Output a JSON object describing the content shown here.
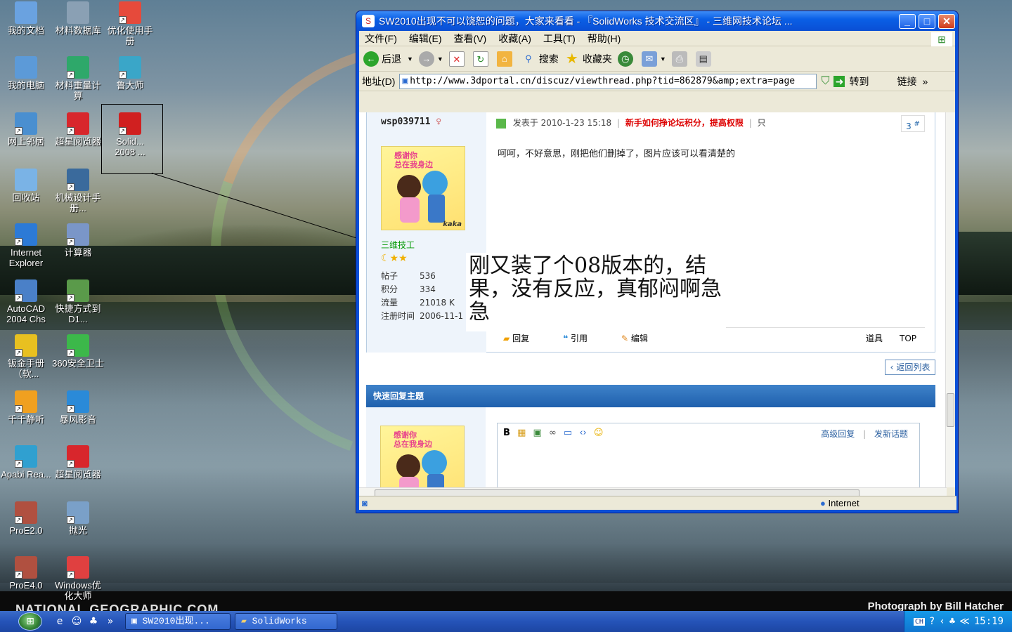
{
  "desktop": {
    "icons": [
      {
        "label": "我的文档",
        "icon": "documents-icon",
        "color": "#6aa2e0"
      },
      {
        "label": "材料数据库",
        "icon": "database-icon",
        "color": "#8aa0b4"
      },
      {
        "label": "优化使用手册",
        "icon": "manual-icon",
        "color": "#e64a3b"
      },
      {
        "label": "我的电脑",
        "icon": "computer-icon",
        "color": "#5c9ad8"
      },
      {
        "label": "材料重量计算",
        "icon": "calculator-icon",
        "color": "#2ea86a"
      },
      {
        "label": "鲁大师",
        "icon": "ludashi-icon",
        "color": "#3aa6c8"
      },
      {
        "label": "网上邻居",
        "icon": "network-icon",
        "color": "#4a8fd0"
      },
      {
        "label": "超星阅览器",
        "icon": "reader-icon",
        "color": "#d8262c"
      },
      {
        "label": "Solid...\n2008 ...",
        "icon": "solidworks-icon",
        "color": "#d02020"
      },
      {
        "label": "回收站",
        "icon": "recycle-bin-icon",
        "color": "#7ab3e6"
      },
      {
        "label": "机械设计手册...",
        "icon": "mech-design-icon",
        "color": "#3a6a9c"
      },
      {
        "label": "Internet Explorer",
        "icon": "ie-icon",
        "color": "#2c7ad6"
      },
      {
        "label": "计算器",
        "icon": "calculator-icon",
        "color": "#7a96c8"
      },
      {
        "label": "AutoCAD 2004 Chs",
        "icon": "autocad-icon",
        "color": "#4a80c8"
      },
      {
        "label": "快捷方式到 D1...",
        "icon": "shortcut-icon",
        "color": "#5a9a4a"
      },
      {
        "label": "钣金手册（软...",
        "icon": "sheetmetal-icon",
        "color": "#e8c020"
      },
      {
        "label": "360安全卫士",
        "icon": "360-icon",
        "color": "#3cb84a"
      },
      {
        "label": "千千静听",
        "icon": "ttplayer-icon",
        "color": "#f0a020"
      },
      {
        "label": "暴风影音",
        "icon": "storm-icon",
        "color": "#2a8ad8"
      },
      {
        "label": "Apabi Rea...",
        "icon": "apabi-icon",
        "color": "#30a0d0"
      },
      {
        "label": "超星阅览器",
        "icon": "reader-icon",
        "color": "#d8262c"
      },
      {
        "label": "ProE2.0",
        "icon": "proe-icon",
        "color": "#b05040"
      },
      {
        "label": "抛光",
        "icon": "polish-icon",
        "color": "#7aa0c8"
      },
      {
        "label": "ProE4.0",
        "icon": "proe-icon",
        "color": "#b05040"
      },
      {
        "label": "Windows优化大师",
        "icon": "optimizer-icon",
        "color": "#e04040"
      }
    ],
    "watermark_left": "NATIONAL GEOGRAPHIC.COM",
    "watermark_right": "Photograph by Bill Hatcher"
  },
  "window": {
    "title": "SW2010出现不可以饶恕的问题，大家来看看 - 『SolidWorks 技术交流区』 - 三维网技术论坛 ...",
    "menu": [
      "文件(F)",
      "编辑(E)",
      "查看(V)",
      "收藏(A)",
      "工具(T)",
      "帮助(H)"
    ],
    "toolbar": {
      "back": "后退",
      "search": "搜索",
      "favorites": "收藏夹"
    },
    "address_label": "地址(D)",
    "url": "http://www.3dportal.cn/discuz/viewthread.php?tid=862879&amp;extra=page",
    "go": "转到",
    "links": "链接",
    "status": "Internet"
  },
  "post": {
    "username": "wsp039711",
    "posted": "发表于 2010-1-23 15:18",
    "newbie_link": "新手如何挣论坛积分，提高权限",
    "only": "只",
    "floor": "3",
    "floor_sup": "#",
    "message": "呵呵，不好意思，刚把他们删掉了，图片应该可以看清楚的",
    "rank": "三维技工",
    "stats": [
      {
        "k": "帖子",
        "v": "536"
      },
      {
        "k": "积分",
        "v": "334"
      },
      {
        "k": "流量",
        "v": "21018 K"
      },
      {
        "k": "注册时间",
        "v": "2006-11-1"
      }
    ],
    "reply": "回复",
    "quote": "引用",
    "edit": "编辑",
    "tools": "道具",
    "top": "TOP",
    "avatar_caption": "感谢你\n总在我身边",
    "avatar_sign": "kaka"
  },
  "annotation": "刚又装了个08版本的，结果，没有反应，真郁闷啊急急",
  "back_to_list": "返回列表",
  "quick_reply": {
    "title": "快速回复主题",
    "advanced": "高级回复",
    "new_topic": "发新话题"
  },
  "taskbar": {
    "tasks": [
      "SW2010出现...",
      "SolidWorks"
    ],
    "lang": "CH",
    "time": "15:19"
  }
}
